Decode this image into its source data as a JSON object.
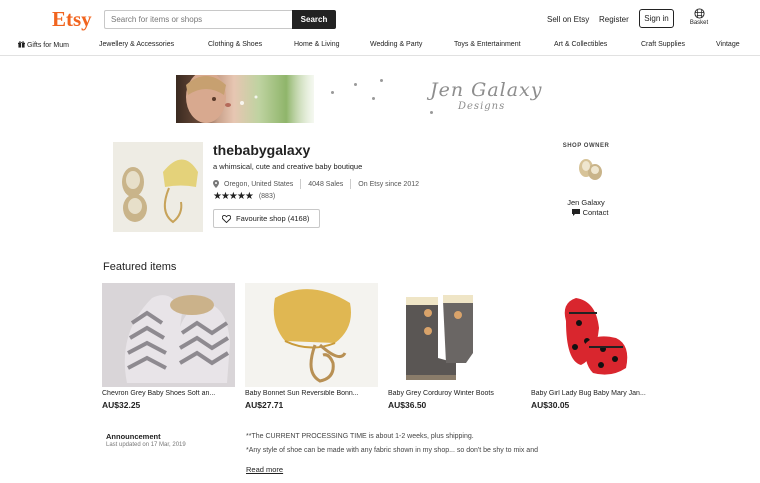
{
  "header": {
    "logo": "Etsy",
    "search_placeholder": "Search for items or shops",
    "search_button": "Search",
    "sell_link": "Sell on Etsy",
    "register_link": "Register",
    "signin_button": "Sign in",
    "basket_label": "Basket",
    "brand_color": "#F1641E"
  },
  "categories": [
    {
      "label": "Gifts for Mum",
      "icon": "gift-icon"
    },
    {
      "label": "Jewellery & Accessories"
    },
    {
      "label": "Clothing & Shoes"
    },
    {
      "label": "Home & Living"
    },
    {
      "label": "Wedding & Party"
    },
    {
      "label": "Toys & Entertainment"
    },
    {
      "label": "Art & Collectibles"
    },
    {
      "label": "Craft Supplies"
    },
    {
      "label": "Vintage"
    }
  ],
  "banner": {
    "line1": "Jen Galaxy",
    "line2": "Designs"
  },
  "shop": {
    "name": "thebabygalaxy",
    "tagline": "a whimsical, cute and creative baby boutique",
    "location": "Oregon, United States",
    "sales": "4048 Sales",
    "since": "On Etsy since 2012",
    "stars": "★★★★★",
    "rating": 5,
    "review_count": "(883)",
    "favourite_button": "Favourite shop (4168)"
  },
  "owner": {
    "label": "SHOP OWNER",
    "name": "Jen Galaxy",
    "contact": "Contact"
  },
  "featured": {
    "title": "Featured items",
    "items": [
      {
        "title": "Chevron Grey Baby Shoes Soft an...",
        "price": "AU$32.25"
      },
      {
        "title": "Baby Bonnet Sun Reversible Bonn...",
        "price": "AU$27.71"
      },
      {
        "title": "Baby Grey Corduroy Winter Boots",
        "price": "AU$36.50"
      },
      {
        "title": "Baby Girl Lady Bug Baby Mary Jan...",
        "price": "AU$30.05"
      }
    ]
  },
  "announcement": {
    "title": "Announcement",
    "updated": "Last updated on 17 Mar, 2019",
    "line1": "**The CURRENT PROCESSING TIME is about 1-2 weeks, plus shipping.",
    "line2": "*Any style of shoe can be made with any fabric shown in my shop... so don't be shy to mix and",
    "read_more": "Read more"
  }
}
